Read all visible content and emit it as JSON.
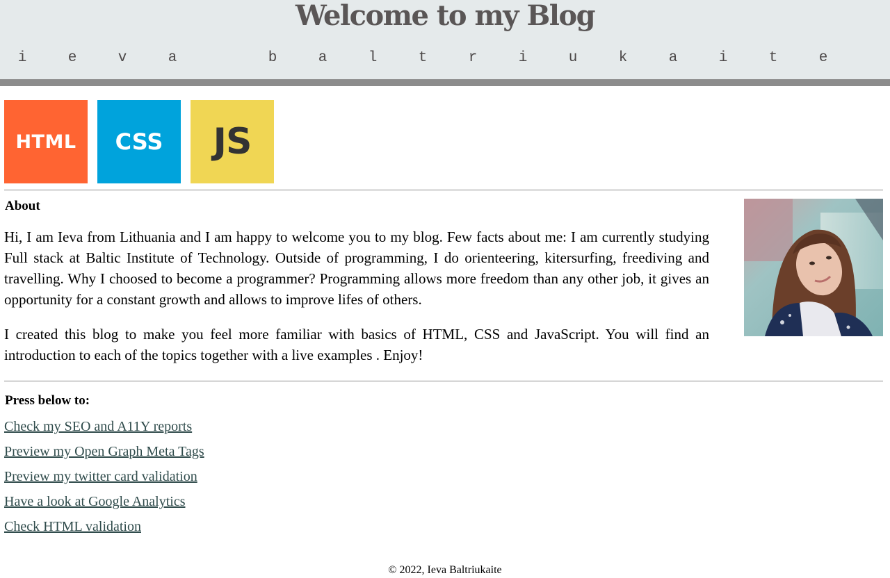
{
  "header": {
    "title": "Welcome to my Blog",
    "author_letters": [
      "i",
      "e",
      "v",
      "a",
      "",
      "b",
      "a",
      "l",
      "t",
      "r",
      "i",
      "u",
      "k",
      "a",
      "i",
      "t",
      "e"
    ]
  },
  "tiles": [
    {
      "label": "HTML",
      "color": "#ff6432"
    },
    {
      "label": "CSS",
      "color": "#00a3dc"
    },
    {
      "label": "JS",
      "color": "#f0d654"
    }
  ],
  "about": {
    "heading": "About",
    "paragraphs": [
      "Hi, I am Ieva from Lithuania and I am happy to welcome you to my blog. Few facts about me: I am currently studying Full stack at Baltic Institute of Technology. Outside of programming, I do orienteering, kitersurfing, freediving and travelling. Why I choosed to become a programmer? Programming allows more freedom than any other job, it gives an opportunity for a constant growth and allows to improve lifes of others.",
      "I created this blog to make you feel more familiar with basics of HTML, CSS and JavaScript. You will find an introduction to each of the topics together with a live examples . Enjoy!"
    ]
  },
  "links_section": {
    "heading": "Press below to:",
    "links": [
      "Check my SEO and A11Y reports",
      "Preview my Open Graph Meta Tags",
      "Preview my twitter card validation",
      "Have a look at Google Analytics",
      "Check HTML validation"
    ]
  },
  "footer": {
    "text": "© 2022, Ieva Baltriukaite"
  },
  "colors": {
    "header_bg": "#e5eaeb",
    "header_bar": "#8c8c8c",
    "title": "#5a5656",
    "link": "#2f4b4b"
  }
}
